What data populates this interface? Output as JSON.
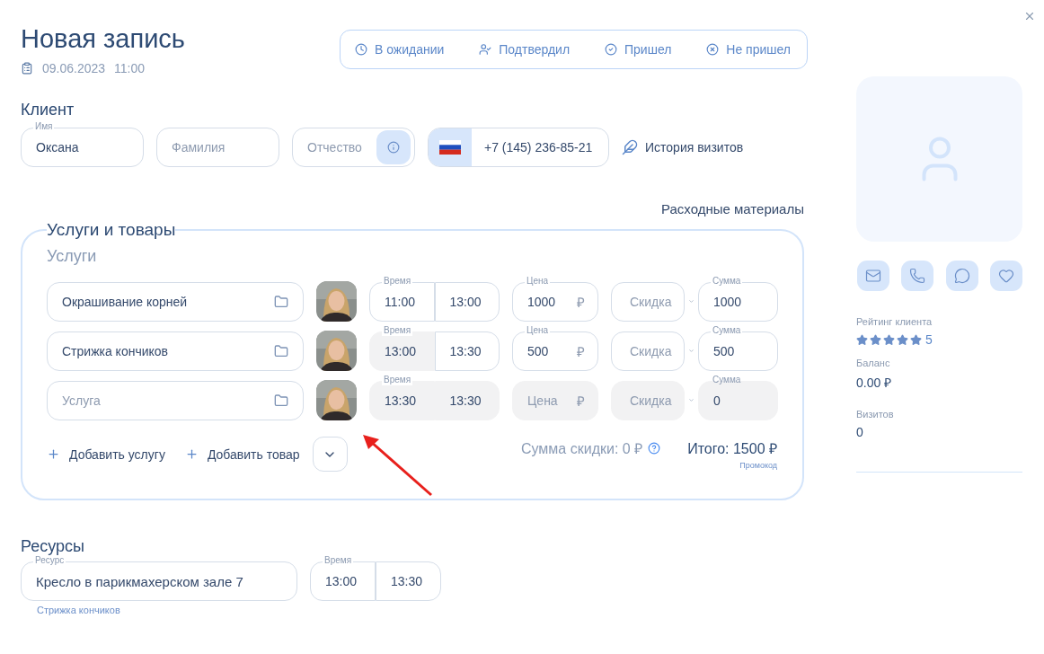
{
  "header": {
    "title": "Новая запись",
    "date": "09.06.2023",
    "time": "11:00"
  },
  "statuses": [
    {
      "label": "В ожидании",
      "selected": false
    },
    {
      "label": "Подтвердил",
      "selected": false
    },
    {
      "label": "Пришел",
      "selected": false
    },
    {
      "label": "Не пришел",
      "selected": false
    }
  ],
  "client": {
    "heading": "Клиент",
    "fields": [
      {
        "kind": "text",
        "label": "Имя",
        "value": "Оксана"
      },
      {
        "kind": "text",
        "placeholder": "Фамилия"
      },
      {
        "kind": "info",
        "placeholder": "Отчество"
      }
    ],
    "phone": "+7 (145) 236-85-21",
    "history_link": "История визитов"
  },
  "consumables_link": "Расходные материалы",
  "services": {
    "title": "Услуги и товары",
    "subtitle": "Услуги",
    "rows": [
      {
        "name": {
          "value": "Окрашивание корней"
        },
        "time_label": "Время",
        "start": {
          "value": "11:00",
          "disabled": false
        },
        "end": {
          "value": "13:00",
          "disabled": false
        },
        "price_label": "Цена",
        "price": {
          "value": "1000",
          "disabled": false
        },
        "currency": "₽",
        "discount": {
          "placeholder": "Скидка",
          "disabled": false
        },
        "sum_label": "Сумма",
        "sum": {
          "value": "1000",
          "disabled": false
        }
      },
      {
        "name": {
          "value": "Стрижка кончиков"
        },
        "time_label": "Время",
        "start": {
          "value": "13:00",
          "disabled": true
        },
        "end": {
          "value": "13:30",
          "disabled": false
        },
        "price_label": "Цена",
        "price": {
          "value": "500",
          "disabled": false
        },
        "currency": "₽",
        "discount": {
          "placeholder": "Скидка",
          "disabled": false
        },
        "sum_label": "Сумма",
        "sum": {
          "value": "500",
          "disabled": false
        }
      },
      {
        "name": {
          "placeholder": "Услуга"
        },
        "time_label": "Время",
        "start": {
          "value": "13:30",
          "disabled": true
        },
        "end": {
          "value": "13:30",
          "disabled": true
        },
        "price": {
          "placeholder": "Цена",
          "disabled": true
        },
        "currency": "₽",
        "discount": {
          "placeholder": "Скидка",
          "disabled": true
        },
        "sum_label": "Сумма",
        "sum": {
          "value": "0",
          "disabled": true
        }
      }
    ],
    "add_service": "Добавить услугу",
    "add_product": "Добавить товар",
    "discount_total": "Сумма скидки: 0 ₽",
    "total": "Итого: 1500 ₽",
    "promo": "Промокод"
  },
  "resources": {
    "heading": "Ресурсы",
    "resource_label": "Ресурс",
    "resource": "Кресло в парикмахерском зале 7",
    "time_label": "Время",
    "start": "13:00",
    "end": "13:30",
    "note": "Стрижка кончиков"
  },
  "profile": {
    "rating_label": "Рейтинг клиента",
    "stars": 5,
    "rating": "5",
    "balance_label": "Баланс",
    "balance": "0.00 ₽",
    "visits_label": "Визитов",
    "visits": "0"
  }
}
